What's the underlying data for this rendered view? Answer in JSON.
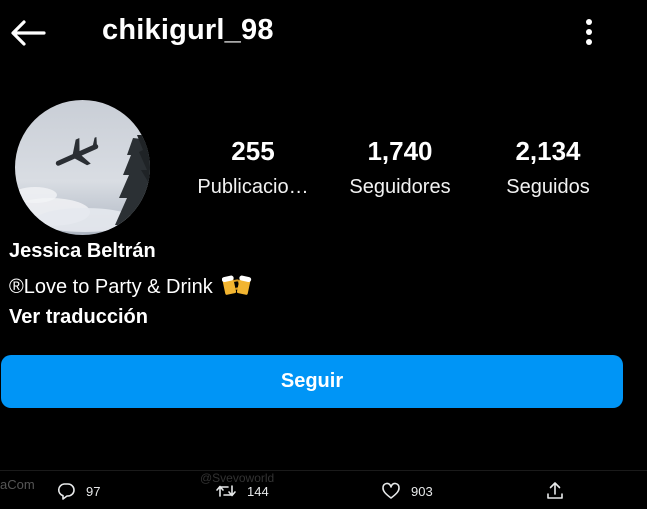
{
  "header": {
    "username": "chikigurl_98",
    "back_icon": "arrow-left-icon",
    "more_icon": "vertical-ellipsis-icon"
  },
  "profile": {
    "avatar": "profile-photo",
    "stats": [
      {
        "number": "255",
        "label": "Publicacio…"
      },
      {
        "number": "1,740",
        "label": "Seguidores"
      },
      {
        "number": "2,134",
        "label": "Seguidos"
      }
    ],
    "name": "Jessica Beltrán",
    "bio": "®Love to Party & Drink",
    "bio_emoji": "beer-mugs-icon",
    "translate_label": "Ver traducción"
  },
  "actions": {
    "follow_label": "Seguir",
    "follow_color": "#0095f6"
  },
  "tweet_bar": {
    "left_fragment": "aCom",
    "faint_text": "@Svevoworld",
    "reply_count": "97",
    "retweet_count": "144",
    "like_count": "903"
  }
}
